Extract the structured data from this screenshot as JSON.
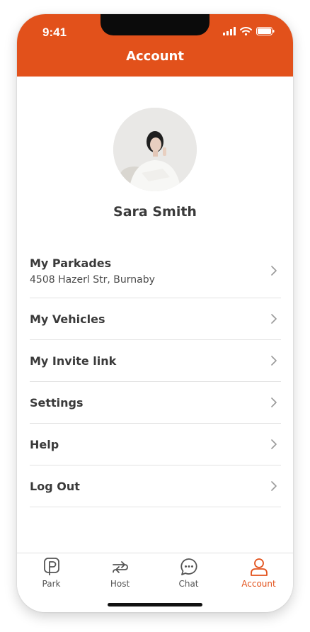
{
  "status_bar": {
    "time": "9:41"
  },
  "header": {
    "title": "Account"
  },
  "profile": {
    "name": "Sara Smith"
  },
  "menu": {
    "items": [
      {
        "label": "My Parkades",
        "sub": "4508 Hazerl Str, Burnaby"
      },
      {
        "label": "My Vehicles"
      },
      {
        "label": "My Invite link"
      },
      {
        "label": "Settings"
      },
      {
        "label": "Help"
      },
      {
        "label": "Log Out"
      }
    ]
  },
  "tabbar": {
    "tabs": [
      {
        "label": "Park",
        "icon": "parking-icon"
      },
      {
        "label": "Host",
        "icon": "host-arrows-icon"
      },
      {
        "label": "Chat",
        "icon": "chat-icon"
      },
      {
        "label": "Account",
        "icon": "user-icon",
        "active": true
      }
    ]
  },
  "colors": {
    "accent": "#E2511B",
    "text": "#3a3a3a",
    "divider": "#e3e3e3"
  }
}
